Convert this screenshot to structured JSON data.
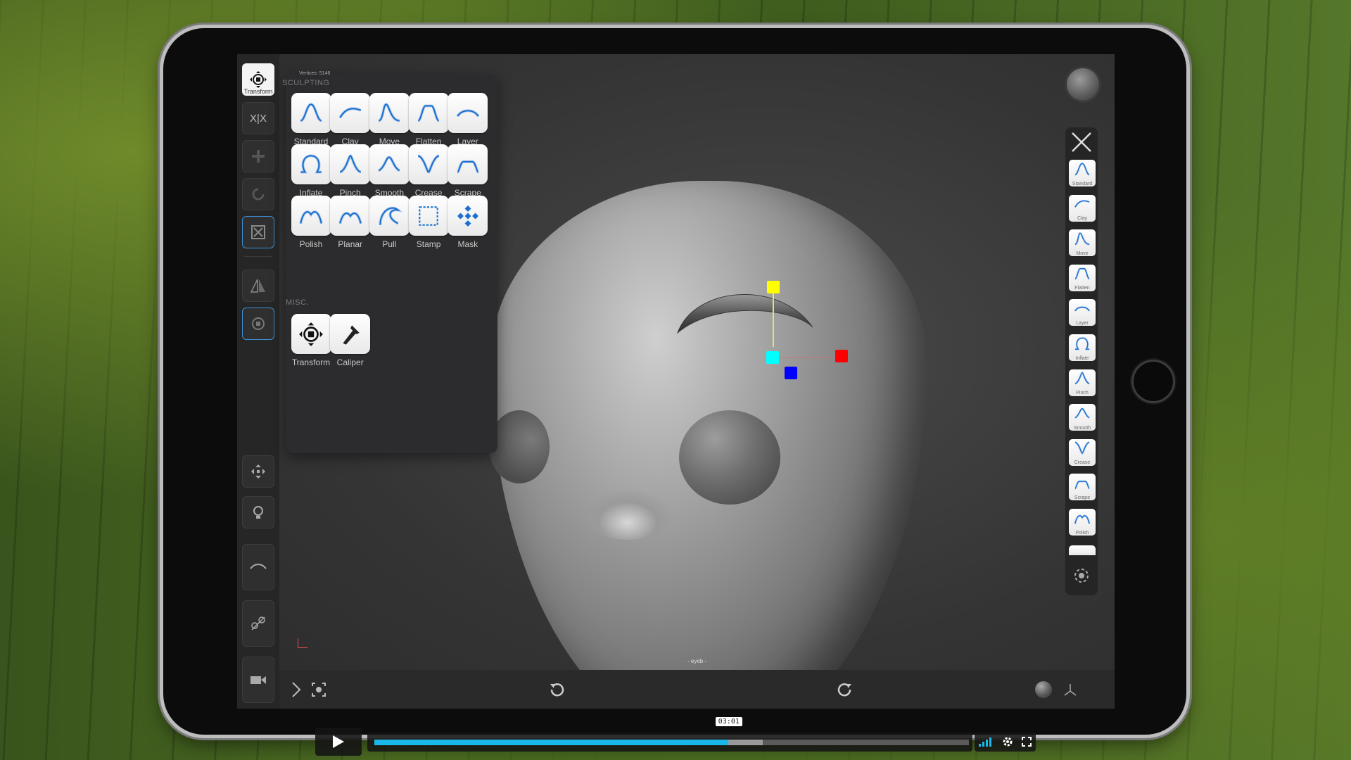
{
  "viewport": {
    "vertices_text": "Vertices: 5146",
    "object_name": "- eyeb -"
  },
  "left_toolbar": {
    "transform_label": "Transform",
    "symmetry_label": "X|X"
  },
  "brush_panel": {
    "sculpting_title": "SCULPTING",
    "misc_title": "MISC.",
    "sculpting_brushes": [
      {
        "label": "Standard",
        "icon": "standard-brush-icon"
      },
      {
        "label": "Clay",
        "icon": "clay-brush-icon"
      },
      {
        "label": "Move",
        "icon": "move-brush-icon"
      },
      {
        "label": "Flatten",
        "icon": "flatten-brush-icon"
      },
      {
        "label": "Layer",
        "icon": "layer-brush-icon"
      },
      {
        "label": "Inflate",
        "icon": "inflate-brush-icon"
      },
      {
        "label": "Pinch",
        "icon": "pinch-brush-icon"
      },
      {
        "label": "Smooth",
        "icon": "smooth-brush-icon"
      },
      {
        "label": "Crease",
        "icon": "crease-brush-icon"
      },
      {
        "label": "Scrape",
        "icon": "scrape-brush-icon"
      },
      {
        "label": "Polish",
        "icon": "polish-brush-icon"
      },
      {
        "label": "Planar",
        "icon": "planar-brush-icon"
      },
      {
        "label": "Pull",
        "icon": "pull-brush-icon"
      },
      {
        "label": "Stamp",
        "icon": "stamp-brush-icon"
      },
      {
        "label": "Mask",
        "icon": "mask-brush-icon"
      }
    ],
    "misc_tools": [
      {
        "label": "Transform",
        "icon": "transform-tool-icon"
      },
      {
        "label": "Caliper",
        "icon": "caliper-tool-icon"
      }
    ]
  },
  "right_toolbar": {
    "items": [
      "Standard",
      "Clay",
      "Move",
      "Flatten",
      "Layer",
      "Inflate",
      "Pinch",
      "Smooth",
      "Crease",
      "Scrape",
      "Polish"
    ]
  },
  "video_player": {
    "current_time": "03:01",
    "progress": 0.595,
    "buffered": 0.653
  },
  "colors": {
    "accent": "#3d8fd6",
    "progress": "#1ab7ea",
    "gizmo_x": "#ff0000",
    "gizmo_y": "#ffff00",
    "gizmo_z": "#0000ff",
    "gizmo_center": "#00ffff"
  }
}
